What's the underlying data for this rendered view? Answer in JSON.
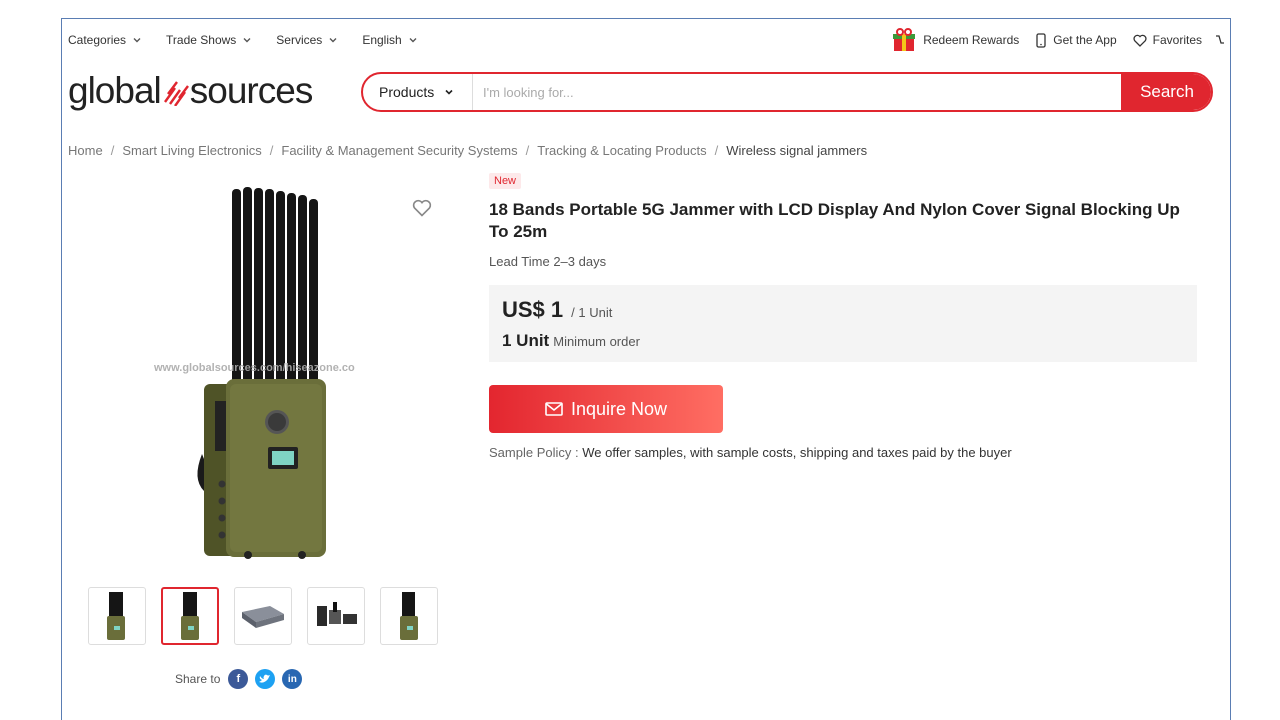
{
  "topnav": {
    "items": [
      {
        "label": "Categories"
      },
      {
        "label": "Trade Shows"
      },
      {
        "label": "Services"
      },
      {
        "label": "English"
      }
    ],
    "right": {
      "rewards": "Redeem Rewards",
      "app": "Get the App",
      "favorites": "Favorites"
    }
  },
  "header": {
    "logo_left": "global",
    "logo_right": "sources",
    "search": {
      "category": "Products",
      "placeholder": "I'm looking for...",
      "button": "Search"
    }
  },
  "breadcrumb": [
    "Home",
    "Smart Living Electronics",
    "Facility & Management Security Systems",
    "Tracking & Locating Products",
    "Wireless signal jammers"
  ],
  "gallery": {
    "watermark": "www.globalsources.com/hiseazone.co",
    "thumb_count": 5,
    "active_thumb": 1
  },
  "product": {
    "badge": "New",
    "title": "18 Bands Portable 5G Jammer with LCD Display And Nylon Cover Signal Blocking Up To 25m",
    "lead_time": "Lead Time 2–3 days",
    "price": "US$ 1",
    "price_unit": "/ 1 Unit",
    "moq": "1 Unit",
    "moq_label": "Minimum order",
    "inquire": "Inquire Now",
    "sample_label": "Sample Policy :",
    "sample_text": "We offer samples, with sample costs, shipping and taxes paid by the buyer"
  },
  "share": {
    "label": "Share to"
  },
  "colors": {
    "brand_red": "#e0262f",
    "facebook": "#3b5998",
    "twitter": "#1da1f2",
    "linkedin": "#2867b2"
  }
}
